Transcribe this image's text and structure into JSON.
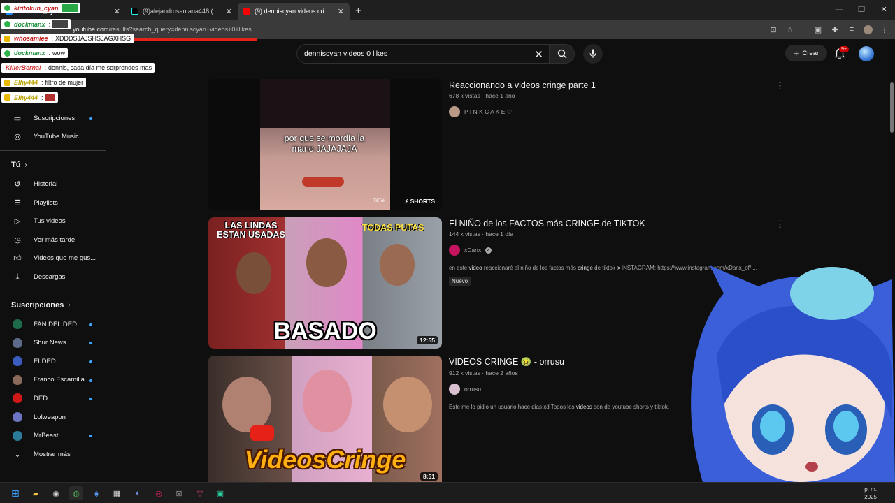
{
  "browser": {
    "tabs": [
      {
        "title": "kiritokun_cyan",
        "active": false
      },
      {
        "title": "(9)alejandrosantana448 (@aleja",
        "active": false
      },
      {
        "title": "(9) denniscyan videos cringe - Y",
        "active": true
      }
    ],
    "url_domain": "youtube.com",
    "url_path": "/results?search_query=denniscyan+videos+0+likes"
  },
  "chat": [
    {
      "user": "kiritokun_cyan",
      "text": "",
      "emote": true
    },
    {
      "user": "dockmanx",
      "text": "",
      "emote": true
    },
    {
      "user": "whosamiee",
      "text": "XDDDSJAJSHSJAGXHSG"
    },
    {
      "user": "dockmanx",
      "text": "wow"
    },
    {
      "user": "KillerBernal",
      "text": "dennis, cada día me sorprendes mas"
    },
    {
      "user": "Elhy444",
      "text": "filtro de mujer"
    },
    {
      "user": "Elhy444",
      "text": "",
      "emote": true
    }
  ],
  "header": {
    "search_value": "denniscyan videos 0 likes",
    "create_label": "Crear",
    "notif_count": "9+"
  },
  "sidebar": {
    "top_items": [
      {
        "label": "Suscripciones",
        "icon": "subscriptions-icon",
        "dot": true
      },
      {
        "label": "YouTube Music",
        "icon": "youtube-music-icon",
        "dot": false
      }
    ],
    "you_heading": "Tú",
    "you_items": [
      {
        "label": "Historial",
        "icon": "history-icon"
      },
      {
        "label": "Playlists",
        "icon": "playlists-icon"
      },
      {
        "label": "Tus videos",
        "icon": "your-videos-icon"
      },
      {
        "label": "Ver más tarde",
        "icon": "watch-later-icon"
      },
      {
        "label": "Videos que me gus...",
        "icon": "like-icon"
      },
      {
        "label": "Descargas",
        "icon": "download-icon"
      }
    ],
    "subs_heading": "Suscripciones",
    "subs": [
      {
        "label": "FAN DEL DED",
        "color": "#1d6b4a",
        "dot": true
      },
      {
        "label": "Shur News",
        "color": "#5d6b8a",
        "dot": true
      },
      {
        "label": "ELDED",
        "color": "#3b5bbf",
        "dot": true
      },
      {
        "label": "Franco Escamilla",
        "color": "#8a6a5a",
        "dot": true
      },
      {
        "label": "DED",
        "color": "#d01818",
        "dot": true
      },
      {
        "label": "Lolweapon",
        "color": "#6b74c0",
        "dot": false
      },
      {
        "label": "MrBeast",
        "color": "#2a7c9a",
        "dot": true
      }
    ],
    "show_more": "Mostrar más"
  },
  "results": [
    {
      "title": "Reaccionando a videos cringe parte 1",
      "stats": "678 k vistas · hace 1 año",
      "channel": "P I N K C A K E ♡",
      "verified": false,
      "description": "",
      "new": false,
      "duration": "SHORTS",
      "overlay_text": "por que se mordía la mano JAJAJAJA",
      "tiktok_label": "TikTok"
    },
    {
      "title": "El NIÑO de los FACTOS más CRINGE de TIKTOK",
      "stats": "144 k vistas · hace 1 día",
      "channel": "xDanx",
      "verified": true,
      "description_parts": [
        "en este ",
        "video",
        " reaccionaré al niño de los factos más ",
        "cringe",
        " de tiktok ➤INSTAGRAM: https://www.instagram.com/xDanx_of/ ..."
      ],
      "new_label": "Nuevo",
      "duration": "12:55",
      "overlay_text_1": "LAS LINDAS ESTAN USADAS",
      "overlay_text_2": "TODAS PUTAS",
      "overlay_text_3": "BASADO"
    },
    {
      "title": "VIDEOS CRINGE 🤢 - orrusu",
      "stats": "912 k vistas · hace 2 años",
      "channel": "orrusu",
      "verified": false,
      "description_parts": [
        "Este me lo pidio un usuario hace dias xd Todos los ",
        "videos",
        " son de youtube shorts y tiktok."
      ],
      "duration": "8:51",
      "overlay_text": "VideosCringe"
    }
  ],
  "taskbar": {
    "time": "p. m.",
    "date": "2025"
  },
  "colors": {
    "background": "#0f0f0f",
    "accent_red": "#e62117",
    "dot_blue": "#3ea6ff"
  }
}
